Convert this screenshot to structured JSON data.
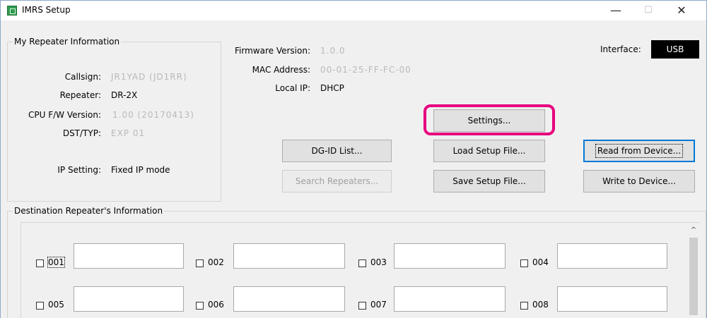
{
  "window": {
    "title": "IMRS Setup",
    "minimize": "—",
    "maximize": "☐",
    "close": "✕"
  },
  "my_repeater": {
    "group_title": "My Repeater Information",
    "callsign_label": "Callsign:",
    "callsign_value": "JR1YAD (JD1RR)",
    "repeater_label": "Repeater:",
    "repeater_value": "DR-2X",
    "cpu_label": "CPU F/W Version:",
    "cpu_value": "1.00 (20170413)",
    "dst_label": "DST/TYP:",
    "dst_value": "EXP 01",
    "ip_setting_label": "IP Setting:",
    "ip_setting_value": "Fixed IP mode"
  },
  "info": {
    "firmware_label": "Firmware Version:",
    "firmware_value": "1.0.0",
    "mac_label": "MAC Address:",
    "mac_value": "00-01-25-FF-FC-00",
    "local_ip_label": "Local IP:",
    "local_ip_value": "DHCP",
    "interface_label": "Interface:",
    "interface_value": "USB"
  },
  "buttons": {
    "settings": "Settings...",
    "dgid_list": "DG-ID List...",
    "load_setup": "Load Setup File...",
    "read_device": "Read from Device...",
    "search_repeaters": "Search Repeaters...",
    "save_setup": "Save Setup File...",
    "write_device": "Write to Device..."
  },
  "destination": {
    "group_title": "Destination Repeater's Information",
    "slots": [
      {
        "id": "001"
      },
      {
        "id": "002"
      },
      {
        "id": "003"
      },
      {
        "id": "004"
      },
      {
        "id": "005"
      },
      {
        "id": "006"
      },
      {
        "id": "007"
      },
      {
        "id": "008"
      }
    ],
    "scroll_up": "^"
  },
  "colors": {
    "highlight": "#e6007e",
    "interface_bg": "#000000",
    "window_bg": "#f0f0f0"
  }
}
